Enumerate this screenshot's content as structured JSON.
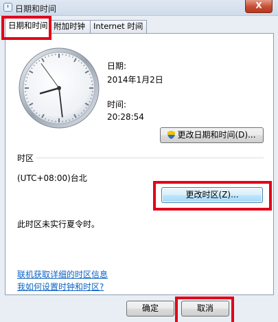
{
  "window": {
    "title": "日期和时间",
    "close_label": "X"
  },
  "tabs": [
    {
      "label": "日期和时间",
      "active": true
    },
    {
      "label": "附加时钟",
      "active": false
    },
    {
      "label": "Internet 时间",
      "active": false
    }
  ],
  "date_section": {
    "date_label": "日期:",
    "date_value": "2014年1月2日",
    "time_label": "时间:",
    "time_value": "20:28:54",
    "change_datetime_button": "更改日期和时间(D)..."
  },
  "clock": {
    "hour": 20,
    "minute": 28,
    "second": 54
  },
  "timezone_section": {
    "heading": "时区",
    "current_zone": "(UTC+08:00)台北",
    "change_timezone_button": "更改时区(Z)...",
    "dst_note": "此时区未实行夏令时。"
  },
  "links": {
    "online_info": "联机获取详细的时区信息",
    "how_to_set": "我如何设置时钟和时区?"
  },
  "footer": {
    "ok_button": "确定",
    "cancel_button": "取消"
  },
  "colors": {
    "highlight": "#e2001a",
    "link": "#0b62c6",
    "focus_border": "#3c7fb1"
  }
}
